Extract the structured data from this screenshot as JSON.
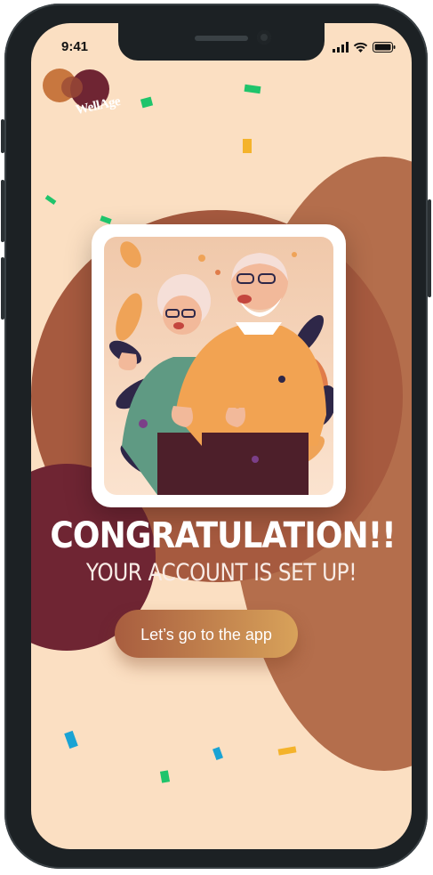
{
  "status_bar": {
    "time": "9:41"
  },
  "brand": {
    "logo_text": "WellAge"
  },
  "main": {
    "title": "CONGRATULATION!!",
    "subtitle": "YOUR ACCOUNT IS SET UP!",
    "cta_label": "Let’s go to the app"
  },
  "colors": {
    "background": "#fbdfc2",
    "brown": "#a65a3f",
    "maroon": "#6f2533",
    "button_start": "#a85d3f",
    "button_end": "#d8a25a"
  },
  "icons": [
    "signal-icon",
    "wifi-icon",
    "battery-icon",
    "logo-icon"
  ]
}
